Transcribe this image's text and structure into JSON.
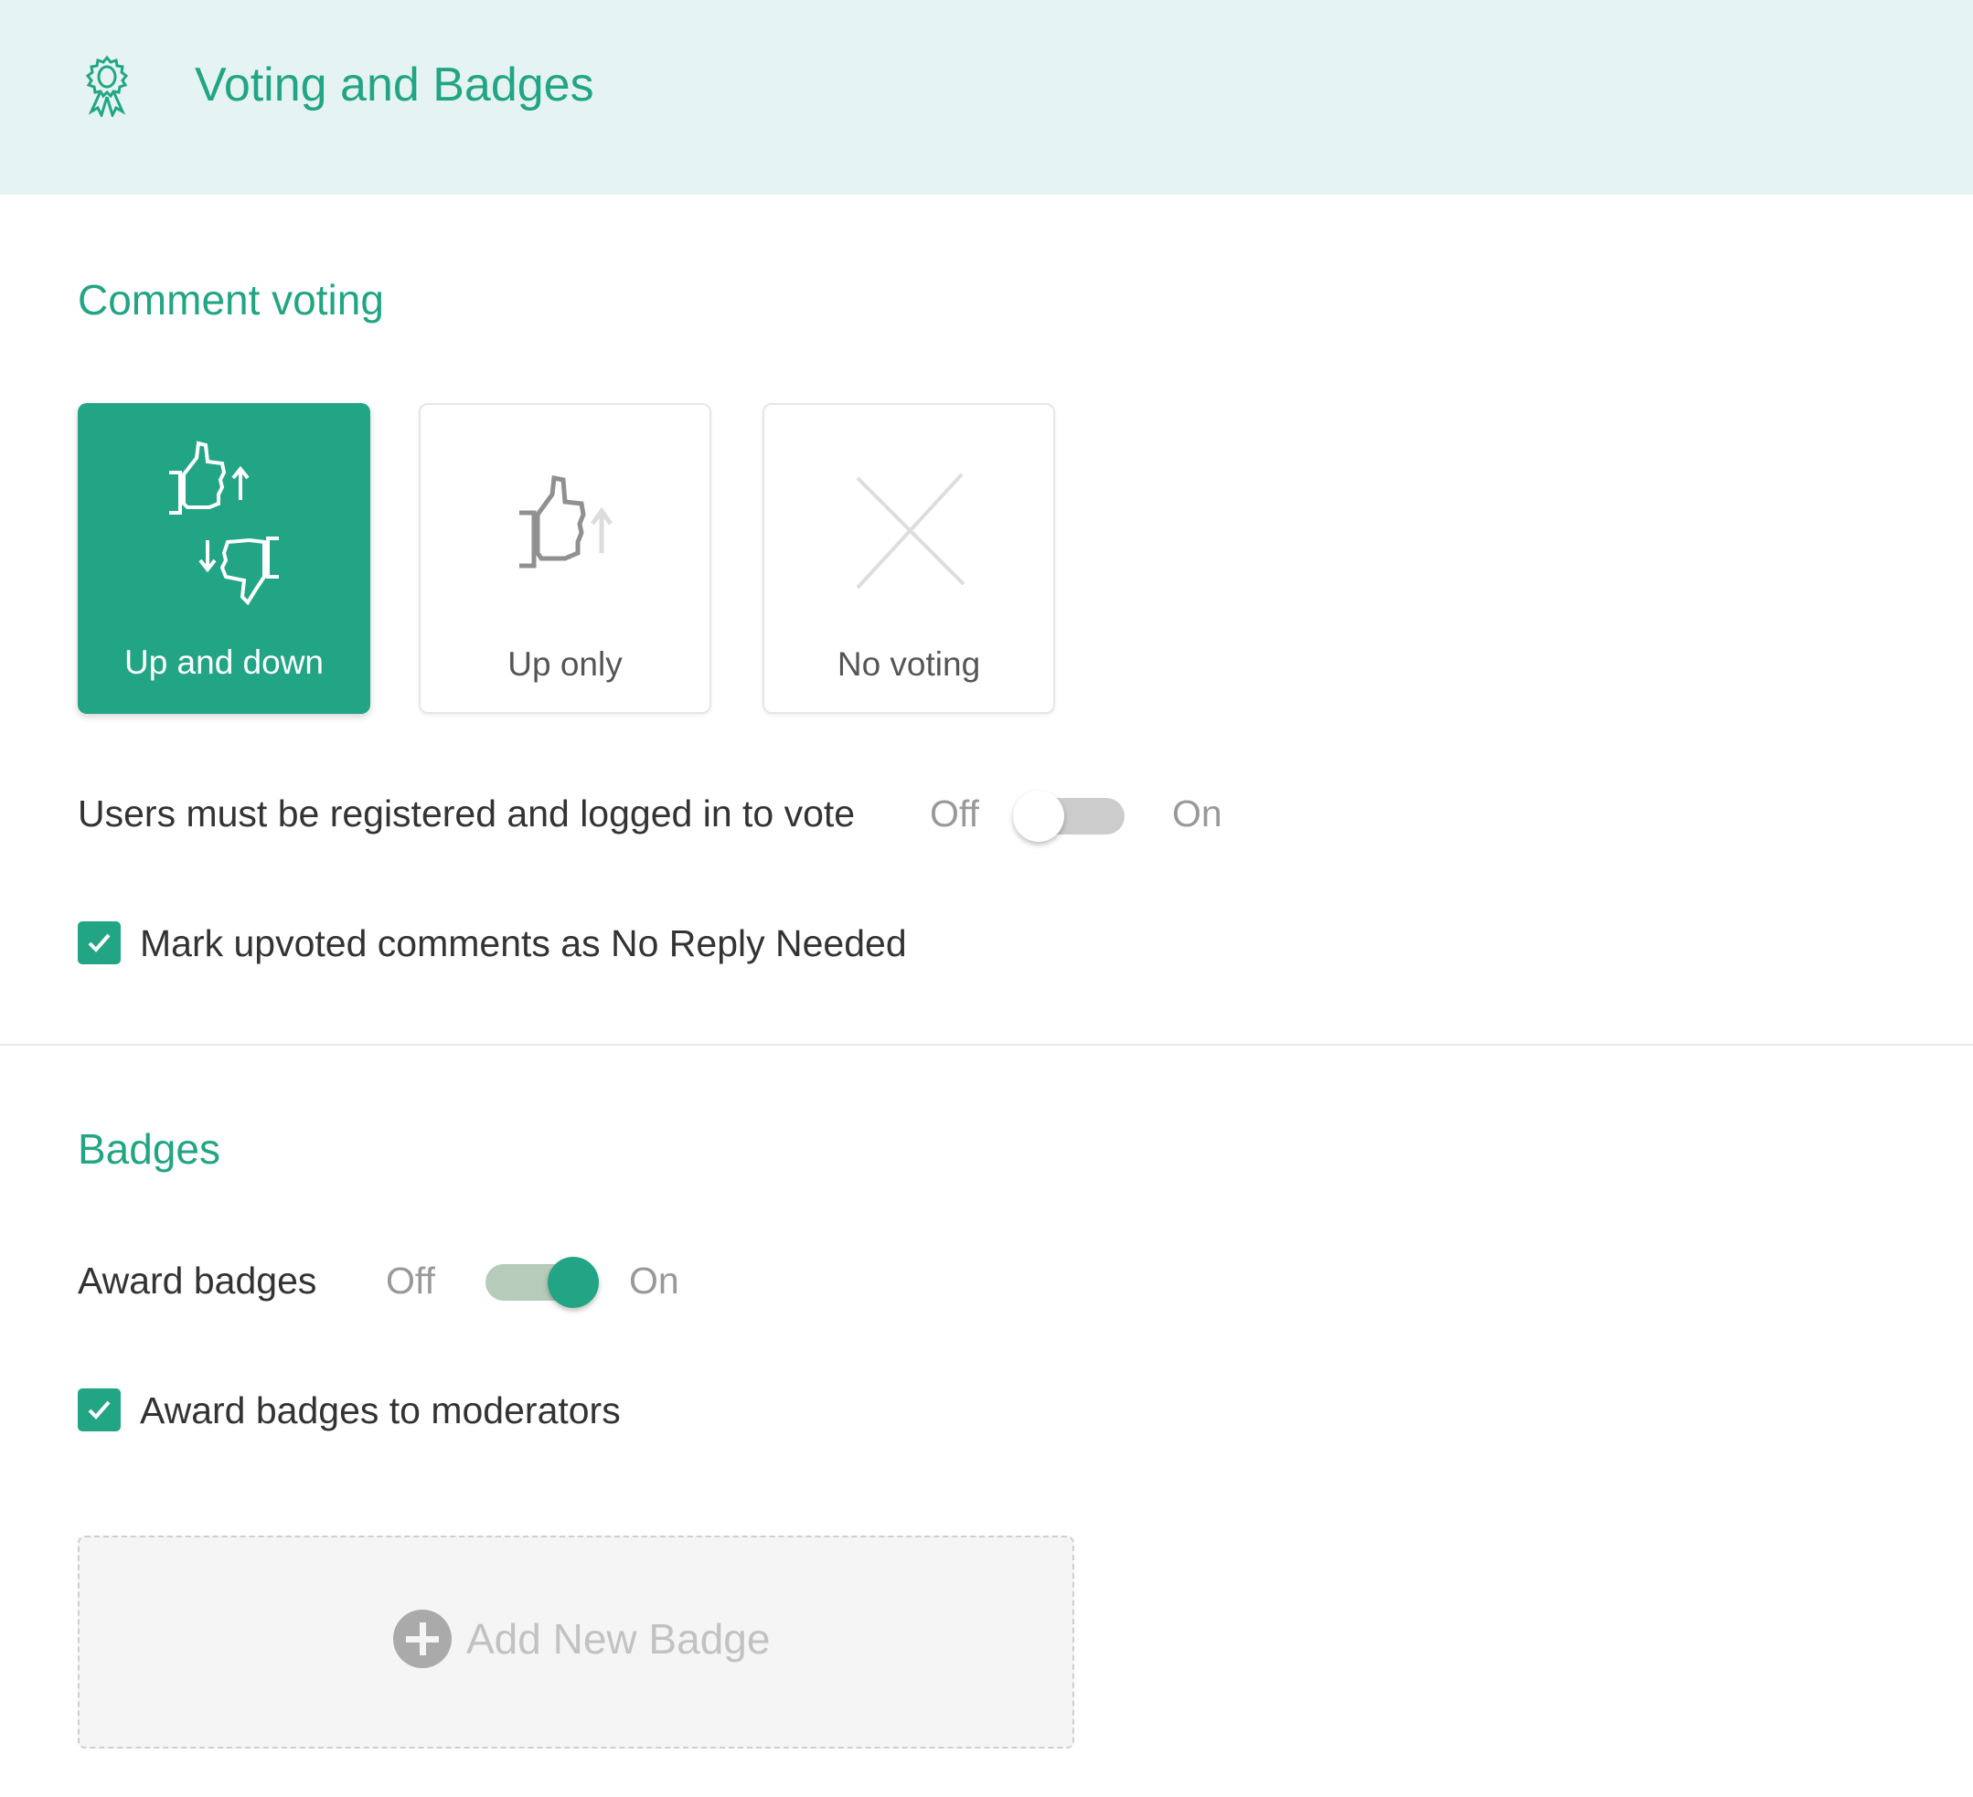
{
  "header": {
    "icon": "award-ribbon-icon",
    "title": "Voting and Badges"
  },
  "comment_voting": {
    "title": "Comment voting",
    "options": [
      {
        "label": "Up and down",
        "icon": "thumbs-up-down-icon",
        "selected": true
      },
      {
        "label": "Up only",
        "icon": "thumbs-up-icon",
        "selected": false
      },
      {
        "label": "No voting",
        "icon": "x-icon",
        "selected": false
      }
    ],
    "registered_toggle": {
      "label": "Users must be registered and logged in to vote",
      "off_label": "Off",
      "on_label": "On",
      "state": "off"
    },
    "mark_upvoted": {
      "label": "Mark upvoted comments as No Reply Needed",
      "checked": true
    }
  },
  "badges": {
    "title": "Badges",
    "award_toggle": {
      "label": "Award badges",
      "off_label": "Off",
      "on_label": "On",
      "state": "on"
    },
    "award_moderators": {
      "label": "Award badges to moderators",
      "checked": true
    },
    "add_button": {
      "label": "Add New Badge",
      "icon": "plus-circle-icon"
    }
  },
  "colors": {
    "accent": "#22a584",
    "header_bg": "#e5f4f2",
    "toggle_off": "#cccccc",
    "toggle_on_track": "#b6cbba"
  }
}
